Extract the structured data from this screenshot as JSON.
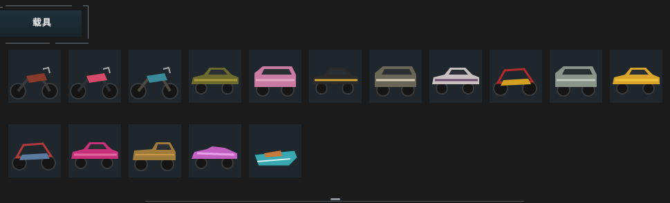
{
  "header": {
    "tab_label": "载具"
  },
  "vehicles": {
    "row1": [
      {
        "icon": "motorcycle-icon",
        "body": "#3a3a3a",
        "accent": "#8a3a2a"
      },
      {
        "icon": "motorcycle-icon",
        "body": "#2e3236",
        "accent": "#d84a6a"
      },
      {
        "icon": "dirtbike-icon",
        "body": "#4c4a3e",
        "accent": "#3a8a9a"
      },
      {
        "icon": "sedan-icon",
        "body": "#6b6a2e",
        "accent": "#a79a3a"
      },
      {
        "icon": "armored-car-icon",
        "body": "#c87aa0",
        "accent": "#e2a8c4"
      },
      {
        "icon": "coupe-icon",
        "body": "#2a2a2a",
        "accent": "#d6a431"
      },
      {
        "icon": "suv-icon",
        "body": "#6a6656",
        "accent": "#d8d0b8"
      },
      {
        "icon": "muscle-car-icon",
        "body": "#c8c0c0",
        "accent": "#6a4a6a"
      },
      {
        "icon": "buggy-icon",
        "body": "#d4a020",
        "accent": "#b32a2a"
      },
      {
        "icon": "jeep-icon",
        "body": "#8a948a",
        "accent": "#c0c8c0"
      },
      {
        "icon": "taxi-icon",
        "body": "#d8a42a",
        "accent": "#f0c040"
      }
    ],
    "row2": [
      {
        "icon": "buggy-icon",
        "body": "#5a7aa0",
        "accent": "#b03a3a"
      },
      {
        "icon": "sedan-icon",
        "body": "#c8307a",
        "accent": "#e06aa0"
      },
      {
        "icon": "pickup-icon",
        "body": "#a07a3a",
        "accent": "#c89a4a"
      },
      {
        "icon": "convertible-icon",
        "body": "#c060c0",
        "accent": "#e8a0e8"
      },
      {
        "icon": "boat-icon",
        "body": "#3aa8b0",
        "accent": "#c87a3a"
      }
    ]
  }
}
